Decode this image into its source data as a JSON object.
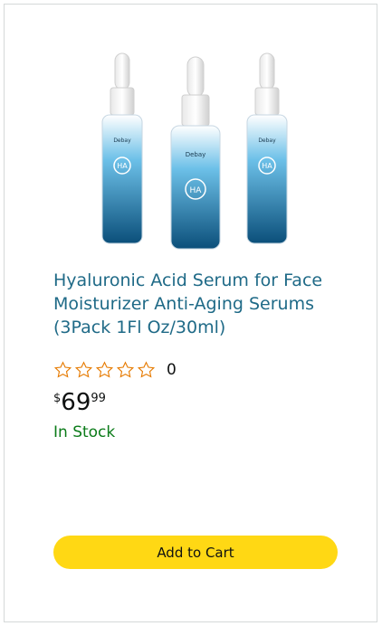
{
  "product": {
    "title": "Hyaluronic Acid Serum for Face Moisturizer Anti-Aging Serums (3Pack 1Fl Oz/30ml)",
    "image_alt": "Three Debay HA serum dropper bottles",
    "brand_on_bottle": "Debay",
    "bottle_badge": "HA",
    "rating_stars": 0,
    "rating_max": 5,
    "review_count": "0",
    "price": {
      "symbol": "$",
      "whole": "69",
      "fraction": "99"
    },
    "stock_status": "In Stock",
    "add_to_cart_label": "Add to Cart"
  },
  "colors": {
    "title": "#1f6a87",
    "star_outline": "#e67a00",
    "stock": "#0b7b19",
    "button": "#ffd814",
    "bottle_blue": "#1d7fb8"
  }
}
